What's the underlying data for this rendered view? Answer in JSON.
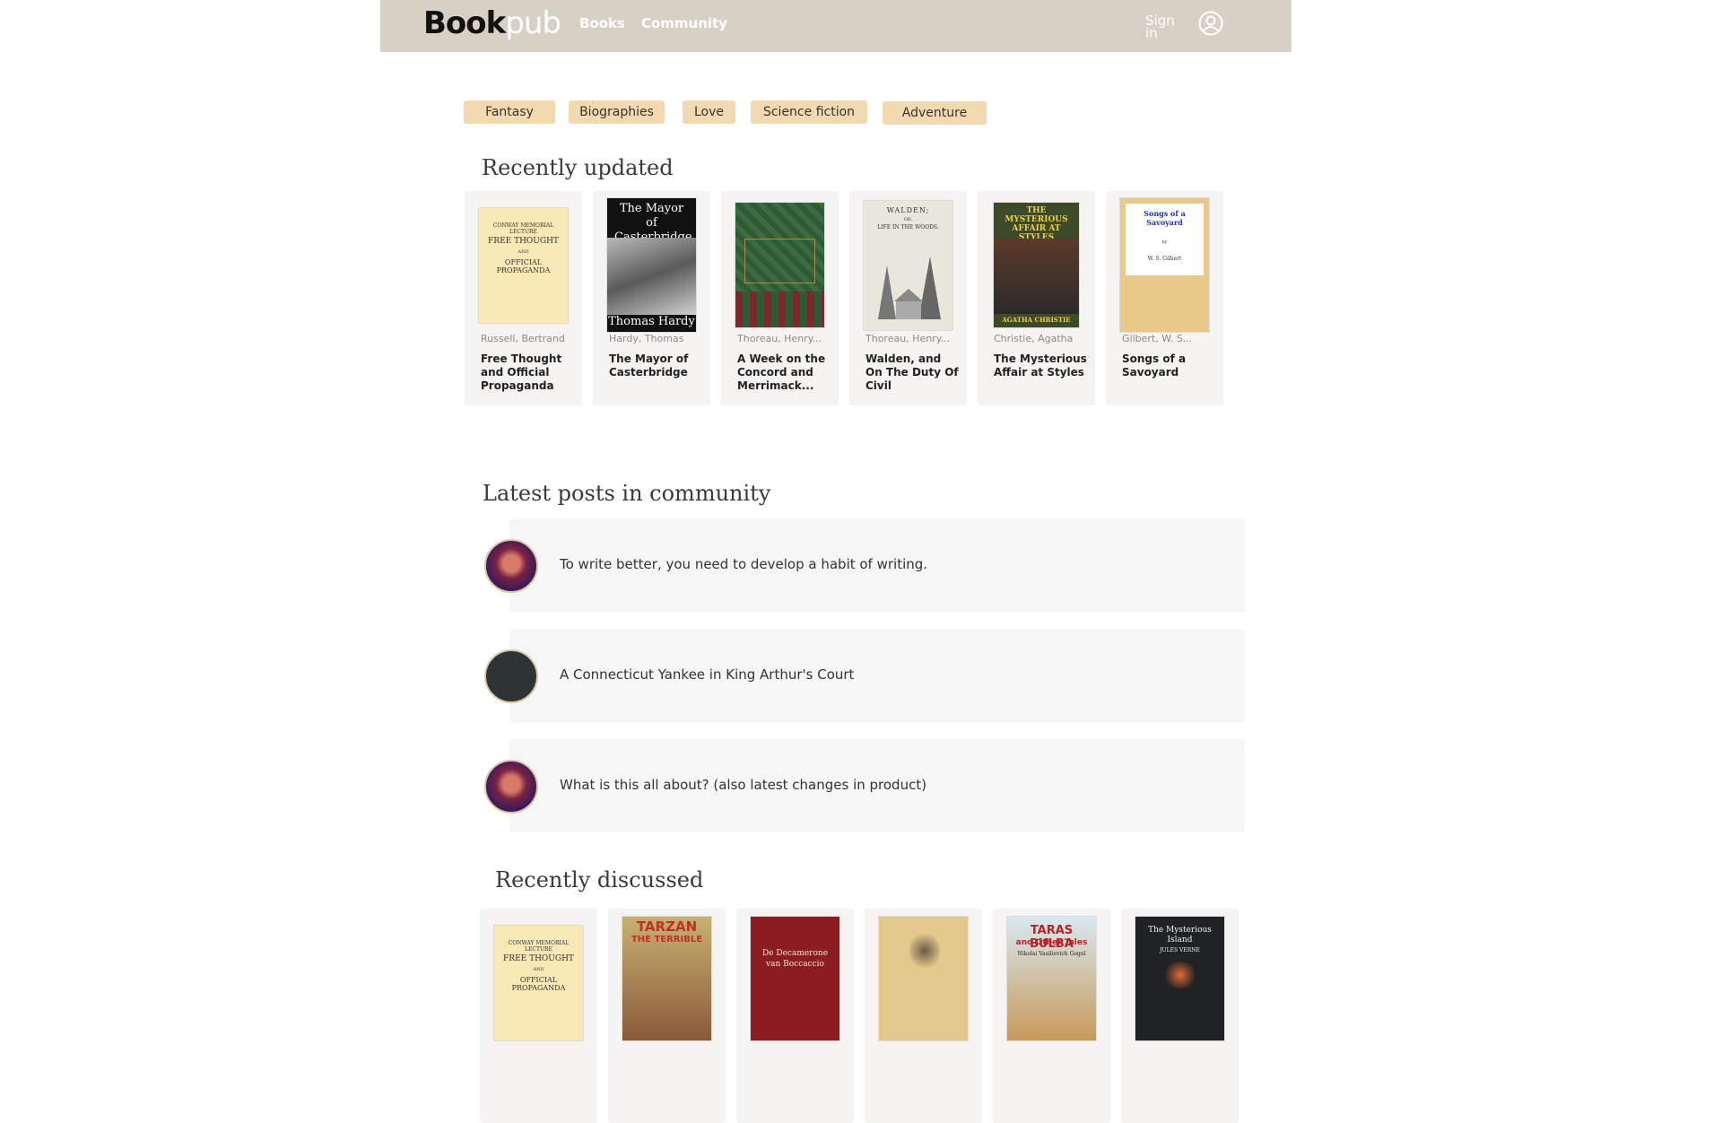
{
  "header": {
    "logo_bold": "Book",
    "logo_light": "pub",
    "nav": [
      "Books",
      "Community"
    ],
    "signin": "Sign in"
  },
  "genres": [
    "Fantasy",
    "Biographies",
    "Love",
    "Science fiction",
    "Adventure"
  ],
  "recently_updated": {
    "title": "Recently updated",
    "books": [
      {
        "author": "Russell, Bertrand",
        "title": "Free Thought and Official Propaganda",
        "cover_lines": [
          "CONWAY MEMORIAL LECTURE",
          "FREE THOUGHT",
          "AND",
          "OFFICIAL PROPAGANDA"
        ]
      },
      {
        "author": "Hardy, Thomas",
        "title": "The Mayor of Casterbridge",
        "cover_lines": [
          "The Mayor of Casterbridge",
          "Thomas Hardy"
        ]
      },
      {
        "author": "Thoreau, Henry...",
        "title": "A Week on the Concord and Merrimack...",
        "cover_lines": []
      },
      {
        "author": "Thoreau, Henry...",
        "title": "Walden, and On The Duty Of Civil Disobedience",
        "cover_lines": [
          "WALDEN;",
          "OR,",
          "LIFE IN THE WOODS."
        ]
      },
      {
        "author": "Christie, Agatha",
        "title": "The Mysterious Affair at Styles",
        "cover_lines": [
          "THE MYSTERIOUS AFFAIR AT STYLES",
          "AGATHA CHRISTIE"
        ]
      },
      {
        "author": "Gilbert, W. S...",
        "title": "Songs of a Savoyard",
        "cover_lines": [
          "Songs of a Savoyard",
          "by",
          "W. S. Gilbert"
        ]
      }
    ]
  },
  "community": {
    "title": "Latest posts in community",
    "posts": [
      {
        "text": "To write better, you need to develop a habit of writing."
      },
      {
        "text": "A Connecticut Yankee in King Arthur's Court"
      },
      {
        "text": "What is this all about? (also latest changes in product)"
      }
    ]
  },
  "recently_discussed": {
    "title": "Recently discussed",
    "books": [
      {
        "cover_lines": [
          "CONWAY MEMORIAL LECTURE",
          "FREE THOUGHT",
          "AND",
          "OFFICIAL PROPAGANDA"
        ]
      },
      {
        "cover_lines": [
          "TARZAN",
          "THE TERRIBLE"
        ]
      },
      {
        "cover_lines": [
          "De Decamerone",
          "van Boccaccio"
        ]
      },
      {
        "cover_lines": []
      },
      {
        "cover_lines": [
          "TARAS BULBA",
          "and Other Tales",
          "Nikolai Vasilievich Gogol"
        ]
      },
      {
        "cover_lines": [
          "The Mysterious Island",
          "JULES VERNE"
        ]
      }
    ]
  },
  "colors": {
    "header_bg": "#d6d0c5",
    "pill_bg": "#f3d9b0",
    "card_bg": "#f5f4f2",
    "post_bg": "#f6f6f6"
  }
}
